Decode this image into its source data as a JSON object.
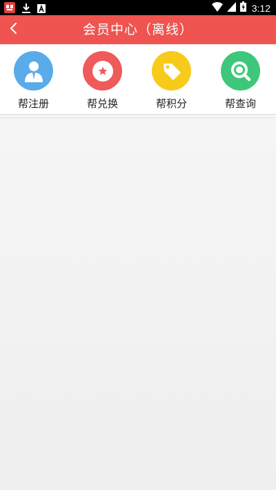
{
  "status_bar": {
    "time": "3:12",
    "left_icons": [
      "notification-app-icon",
      "download-icon",
      "font-app-icon"
    ],
    "right_icons": [
      "wifi-icon",
      "signal-icon",
      "battery-icon"
    ]
  },
  "header": {
    "title": "会员中心（离线）",
    "back_icon": "chevron-left-icon",
    "color": "#ef5450"
  },
  "menu": {
    "items": [
      {
        "label": "帮注册",
        "icon": "user-icon",
        "color": "#5aabea"
      },
      {
        "label": "帮兑换",
        "icon": "star-icon",
        "color": "#ef5a5a"
      },
      {
        "label": "帮积分",
        "icon": "tag-icon",
        "color": "#f6cb1b"
      },
      {
        "label": "帮查询",
        "icon": "search-icon",
        "color": "#3ec77a"
      }
    ]
  }
}
